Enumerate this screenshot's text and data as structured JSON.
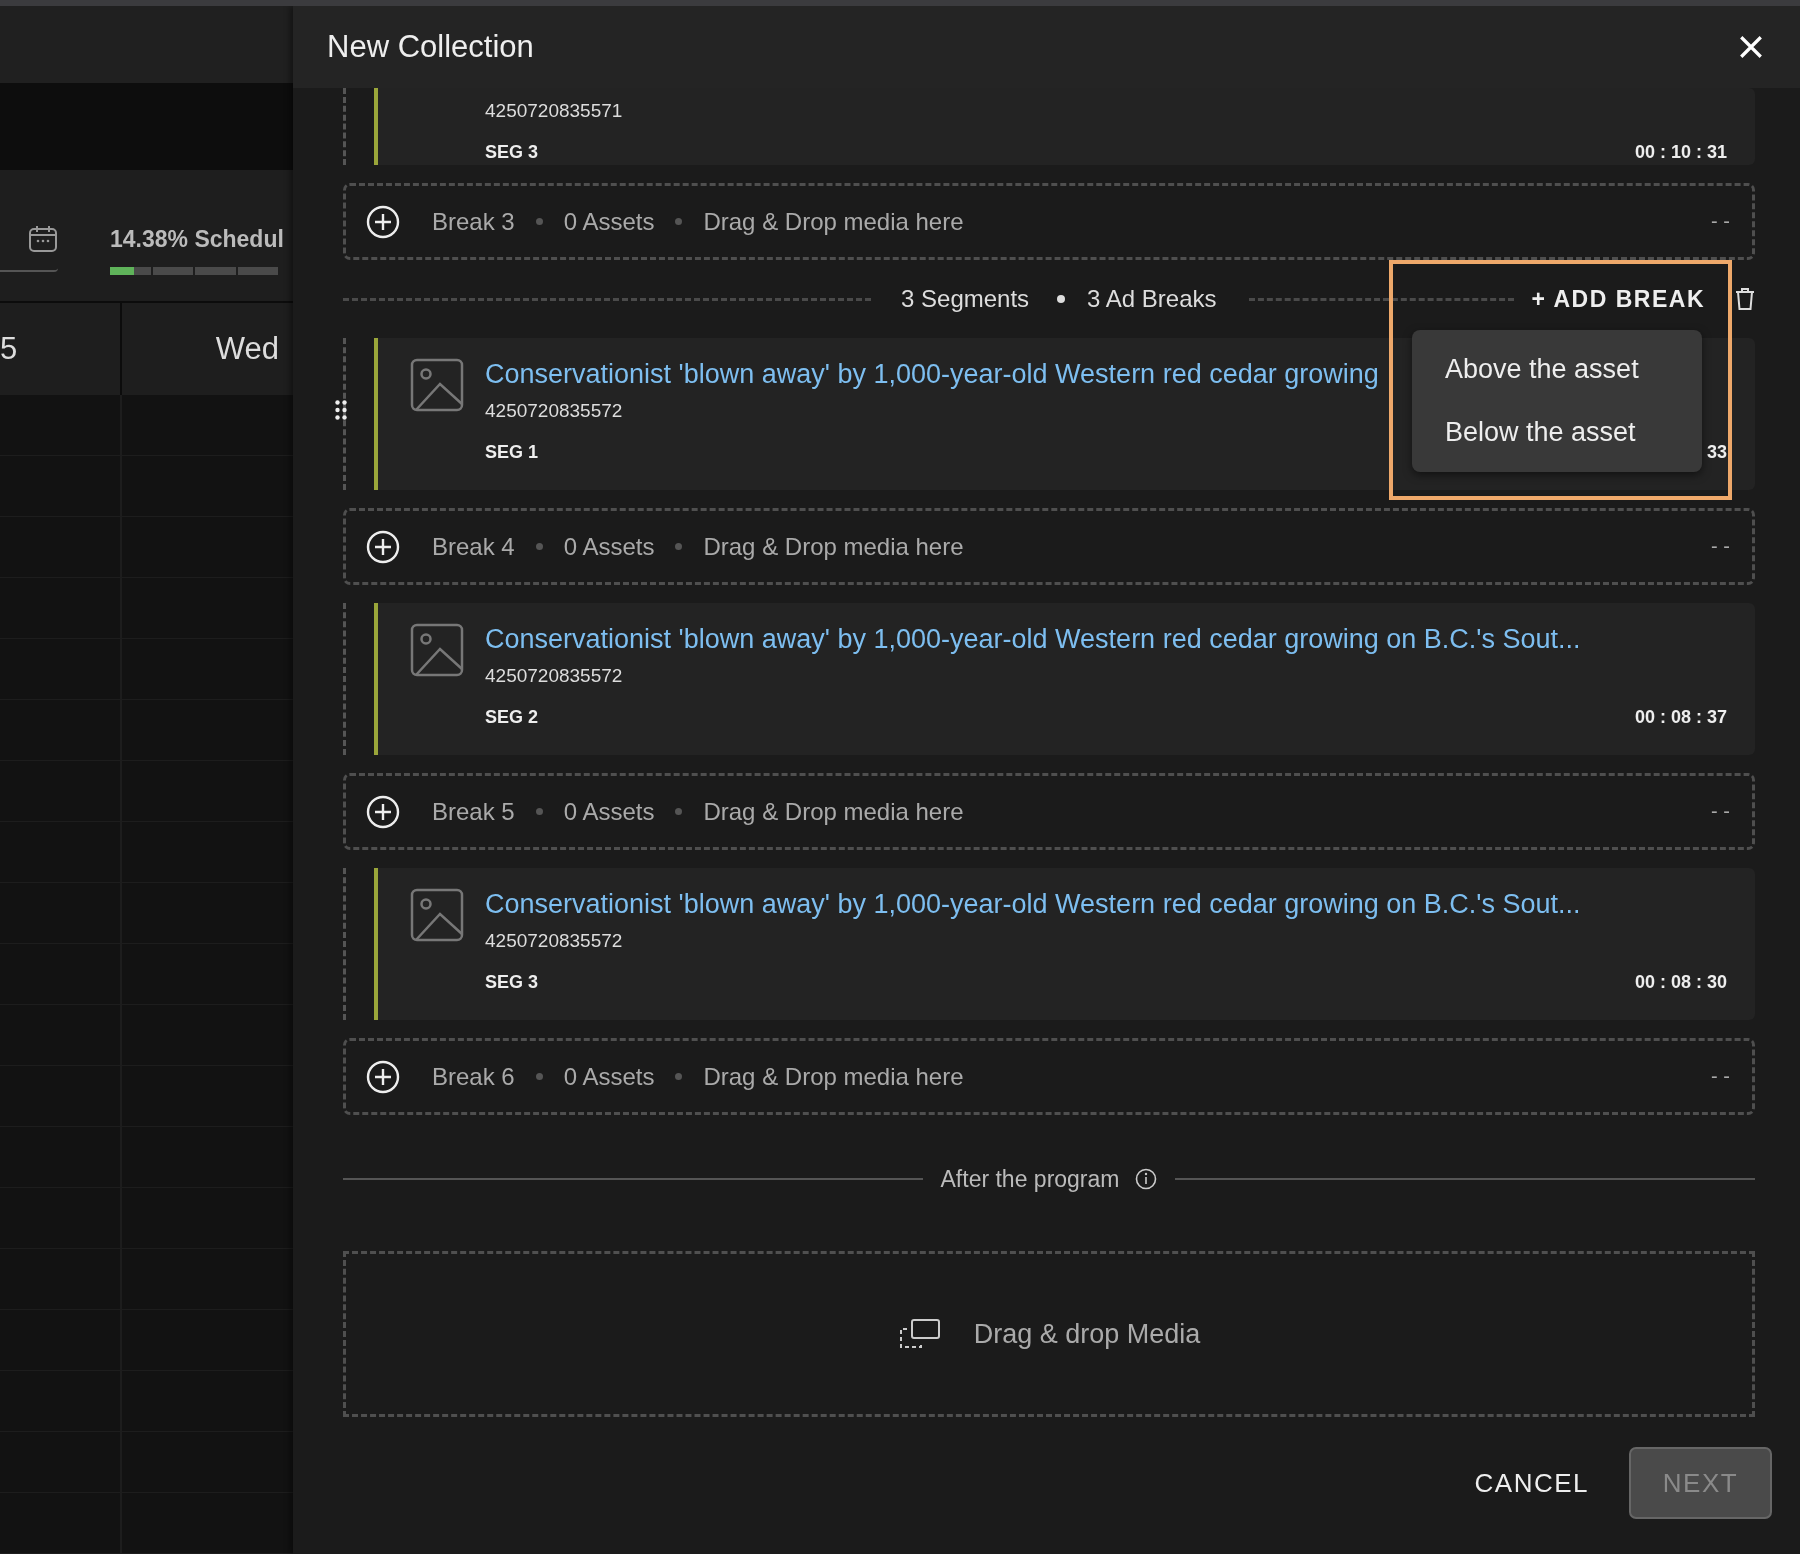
{
  "background": {
    "progress": {
      "label": "14.38% Schedul",
      "level": 0.1438
    },
    "day_labels": [
      "5",
      "Wed"
    ]
  },
  "dialog": {
    "title": "New Collection"
  },
  "items": [
    {
      "kind": "segment",
      "show_handle": false,
      "id": "4250720835571",
      "seg": "SEG 3",
      "duration": "00 : 10 : 31"
    },
    {
      "kind": "break",
      "label": "Break 3",
      "assets": "0 Assets",
      "hint": "Drag & Drop media here",
      "duration": "- -"
    },
    {
      "kind": "summary",
      "segments": "3 Segments",
      "breaks": "3 Ad Breaks",
      "action": "+ ADD BREAK",
      "menu": [
        "Above the asset",
        "Below the asset"
      ]
    },
    {
      "kind": "segment",
      "show_handle": true,
      "title": "Conservationist 'blown away' by 1,000-year-old Western red cedar growing",
      "id": "4250720835572",
      "seg": "SEG 1",
      "duration": "33"
    },
    {
      "kind": "break",
      "label": "Break 4",
      "assets": "0 Assets",
      "hint": "Drag & Drop media here",
      "duration": "- -"
    },
    {
      "kind": "segment",
      "show_handle": false,
      "title": "Conservationist 'blown away' by 1,000-year-old Western red cedar growing on B.C.'s Sout...",
      "id": "4250720835572",
      "seg": "SEG 2",
      "duration": "00 : 08 : 37"
    },
    {
      "kind": "break",
      "label": "Break 5",
      "assets": "0 Assets",
      "hint": "Drag & Drop media here",
      "duration": "- -"
    },
    {
      "kind": "segment",
      "show_handle": false,
      "title": "Conservationist 'blown away' by 1,000-year-old Western red cedar growing on B.C.'s Sout...",
      "id": "4250720835572",
      "seg": "SEG 3",
      "duration": "00 : 08 : 30"
    },
    {
      "kind": "break",
      "label": "Break 6",
      "assets": "0 Assets",
      "hint": "Drag & Drop media here",
      "duration": "- -"
    }
  ],
  "after": {
    "label": "After the program",
    "drop_label": "Drag & drop Media"
  },
  "footer": {
    "cancel": "CANCEL",
    "next": {
      "label": "NEXT",
      "disabled": true
    }
  }
}
